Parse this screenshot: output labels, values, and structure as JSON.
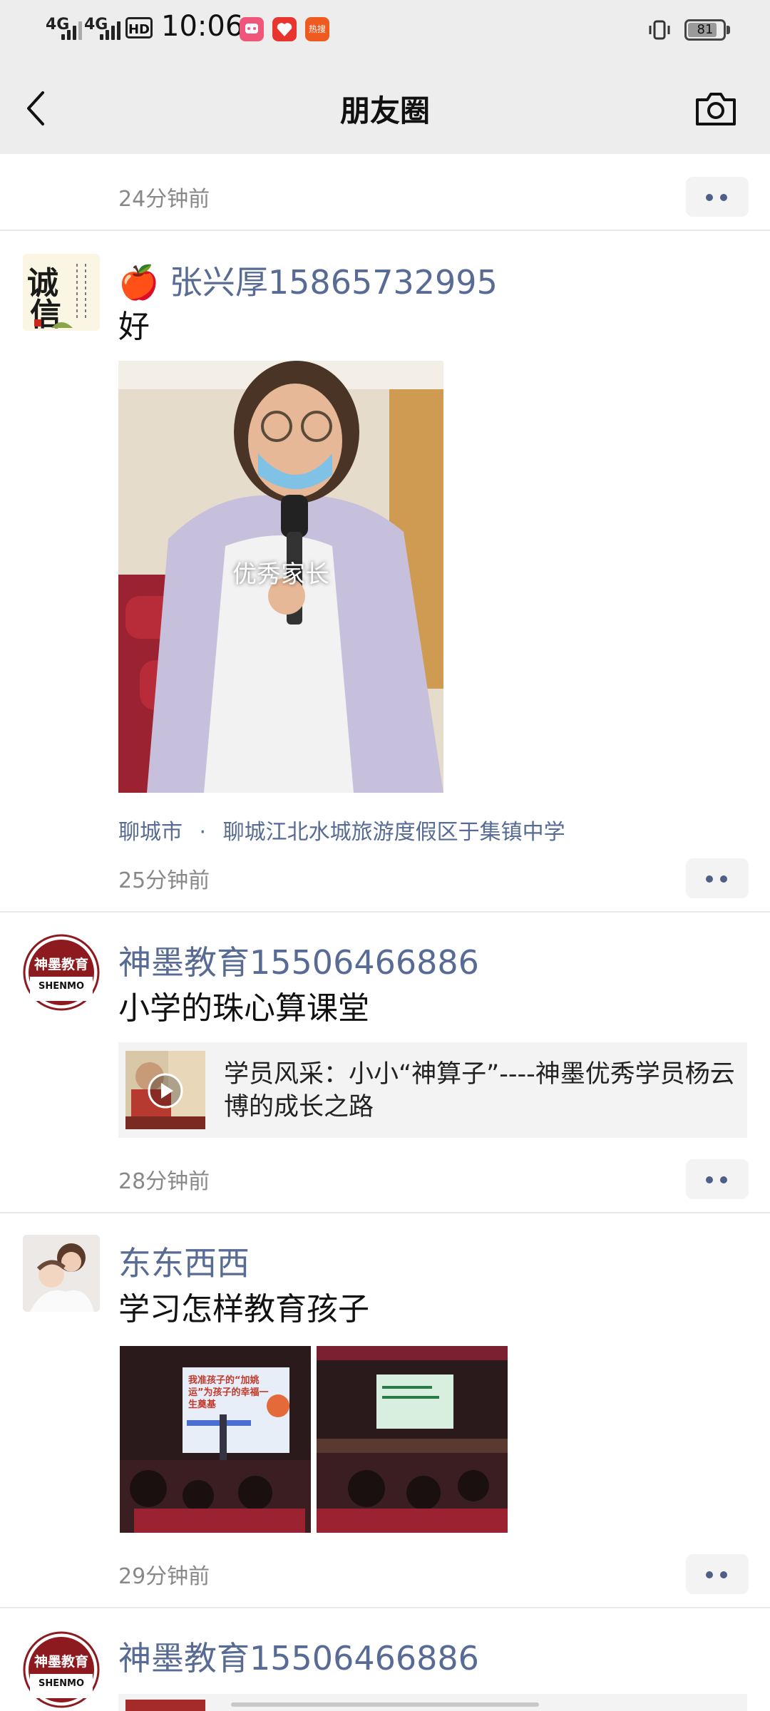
{
  "status_bar": {
    "network_1": "4G",
    "network_2": "4G",
    "hd_badge": "HD",
    "time": "10:06",
    "app_badge_3": "热搜",
    "battery_level": "81"
  },
  "nav": {
    "title": "朋友圈"
  },
  "posts": [
    {
      "time": "24分钟前"
    },
    {
      "avatar_text": "诚信",
      "name": "🍎 张兴厚15865732995",
      "text": "好",
      "image_caption": "优秀家长",
      "location_city": "聊城市",
      "location_separator": "·",
      "location_place": "聊城江北水城旅游度假区于集镇中学",
      "time": "25分钟前"
    },
    {
      "avatar_text": "神墨教育",
      "avatar_sub": "SHENMO",
      "name": "神墨教育15506466886",
      "text": "小学的珠心算课堂",
      "link_title": "学员风采：小小“神算子”----神墨优秀学员杨云博的成长之路",
      "time": "28分钟前"
    },
    {
      "name": "东东西西",
      "text": "学习怎样教育孩子",
      "image_1_text": "我准孩子的“加姚运”为孩子的幸福一生奠基",
      "time": "29分钟前"
    },
    {
      "avatar_text": "神墨教育",
      "avatar_sub": "SHENMO",
      "name": "神墨教育15506466886"
    }
  ]
}
